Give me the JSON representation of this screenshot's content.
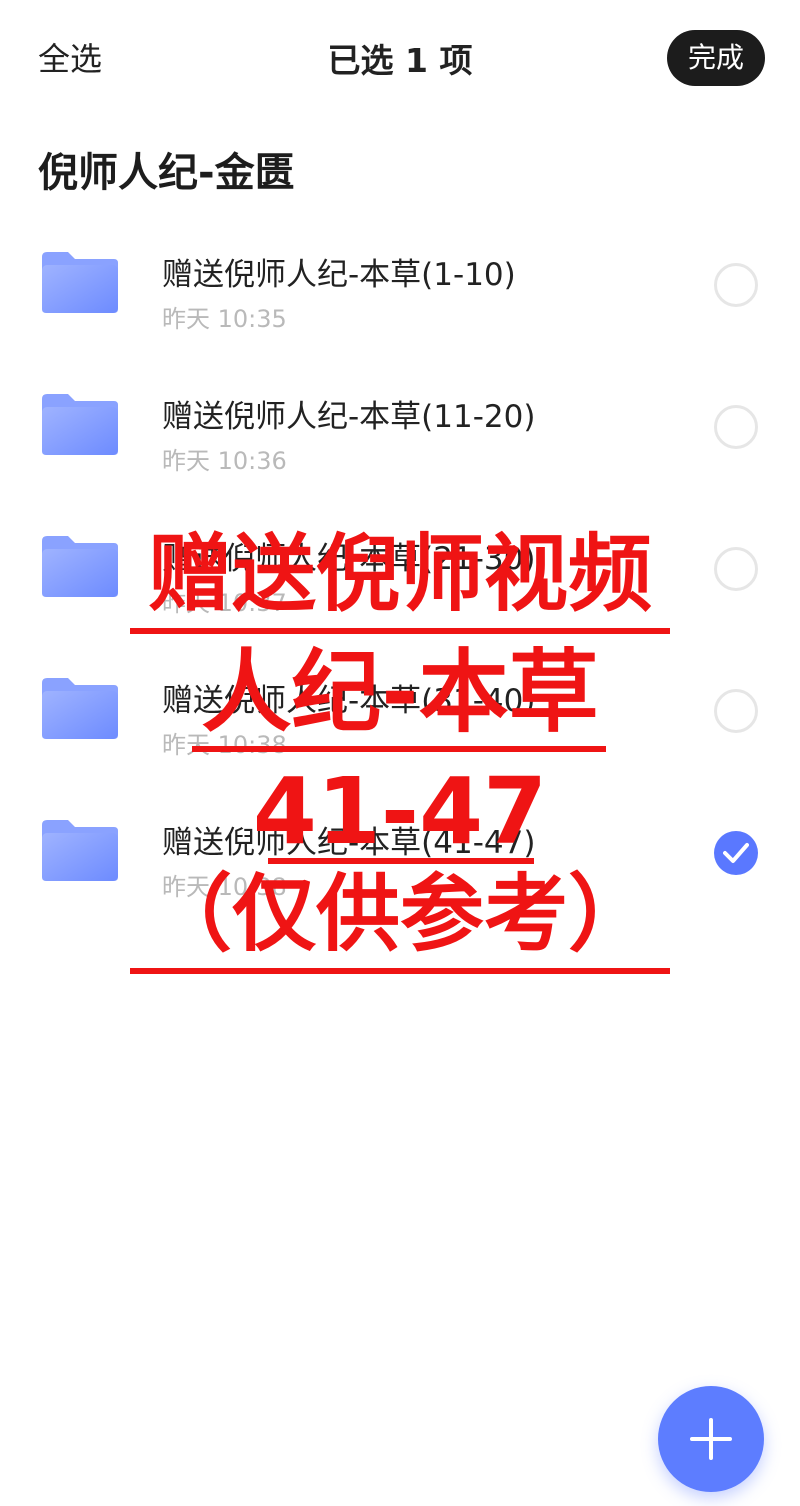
{
  "topbar": {
    "select_all_label": "全选",
    "selected_count_label": "已选 1 项",
    "done_label": "完成"
  },
  "folder_title": "倪师人纪-金匮",
  "items": [
    {
      "name": "赠送倪师人纪-本草(1-10)",
      "time": "昨天 10:35",
      "selected": false
    },
    {
      "name": "赠送倪师人纪-本草(11-20)",
      "time": "昨天 10:36",
      "selected": false
    },
    {
      "name": "赠送倪师人纪-本草(21-30)",
      "time": "昨天 10:37",
      "selected": false
    },
    {
      "name": "赠送倪师人纪-本草(31-40)",
      "time": "昨天 10:38",
      "selected": false
    },
    {
      "name": "赠送倪师人纪-本草(41-47)",
      "time": "昨天 10:38",
      "selected": true
    }
  ],
  "overlay_text": {
    "line1": "赠送倪师视频",
    "line2": "人纪-本草",
    "line3": "41-47",
    "line4": "（仅供参考）"
  },
  "icons": {
    "folder": "folder-icon",
    "check": "check-icon",
    "add": "plus-icon"
  },
  "colors": {
    "accent": "#5a78ff",
    "overlay_red": "#ef1414",
    "done_bg": "#1c1c1c",
    "time_gray": "#b9b9b9"
  }
}
